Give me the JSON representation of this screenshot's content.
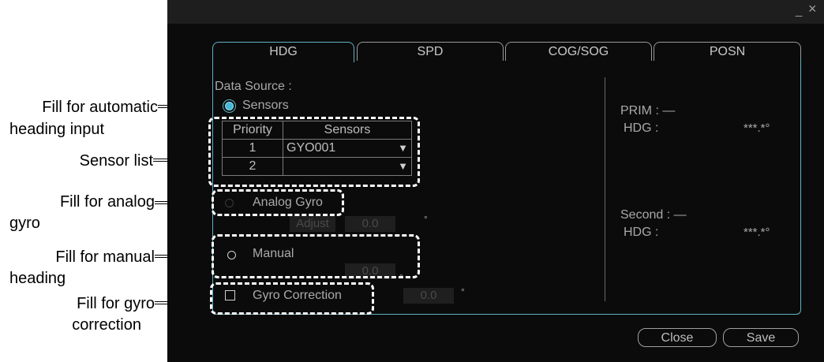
{
  "annotations": [
    {
      "id": "automatic",
      "line1": "Fill for automatic",
      "line2": "heading input"
    },
    {
      "id": "sensor_list",
      "line1": "Sensor list",
      "line2": ""
    },
    {
      "id": "analog",
      "line1": "Fill for analog",
      "line2": "gyro"
    },
    {
      "id": "manual",
      "line1": "Fill for manual",
      "line2": "heading"
    },
    {
      "id": "gyro_corr",
      "line1": "Fill for gyro",
      "line2": "correction"
    }
  ],
  "window": {
    "minimize": "_",
    "close": "×"
  },
  "tabs": [
    "HDG",
    "SPD",
    "COG/SOG",
    "POSN"
  ],
  "active_tab": "HDG",
  "data_source": {
    "label": "Data Source :",
    "sensors_label": "Sensors",
    "table": {
      "headers": [
        "Priority",
        "Sensors"
      ],
      "rows": [
        {
          "priority": "1",
          "sensor": "GYO001"
        },
        {
          "priority": "2",
          "sensor": ""
        }
      ]
    },
    "analog_gyro_label": "Analog Gyro",
    "adjust_label": "Adjust",
    "adjust_value": "0.0",
    "degree": "°",
    "manual_label": "Manual",
    "manual_value": "0.0",
    "gyro_correction_label": "Gyro Correction",
    "gyro_correction_value": "0.0"
  },
  "status": {
    "prim_label": "PRIM : —",
    "prim_hdg_label": "HDG :",
    "prim_hdg_value": "***.*°",
    "second_label": "Second : —",
    "second_hdg_label": "HDG :",
    "second_hdg_value": "***.*°"
  },
  "buttons": {
    "close": "Close",
    "save": "Save"
  },
  "colors": {
    "accent": "#5fb3c3",
    "radio_selected": "#46b8d8",
    "background": "#0b0b0b"
  }
}
